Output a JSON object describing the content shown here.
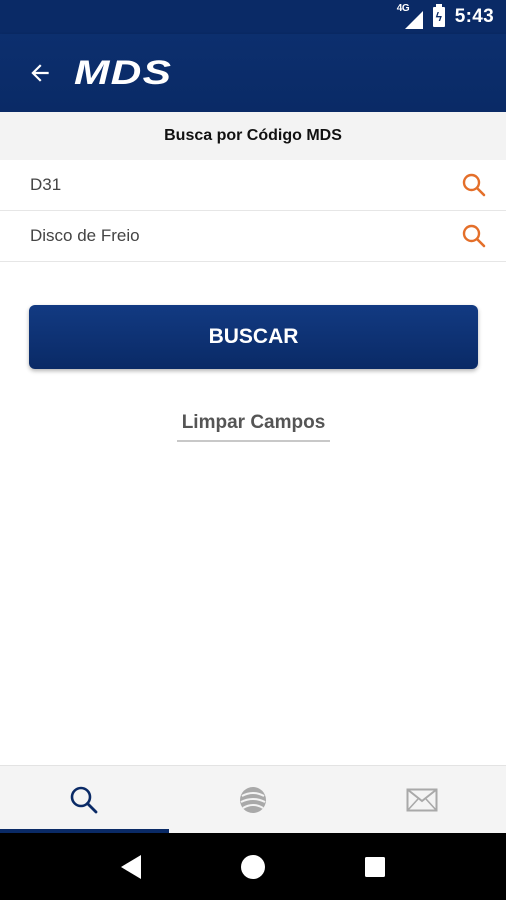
{
  "status_bar": {
    "network_label": "4G",
    "time": "5:43"
  },
  "app_bar": {
    "back_icon": "arrow-left-icon",
    "logo_text": "MDS"
  },
  "section": {
    "title": "Busca por Código MDS"
  },
  "fields": [
    {
      "value": "D31",
      "icon": "search-icon"
    },
    {
      "value": "Disco de Freio",
      "icon": "search-icon"
    }
  ],
  "actions": {
    "search_label": "BUSCAR",
    "clear_label": "Limpar Campos"
  },
  "bottom_nav": {
    "items": [
      {
        "icon": "search-icon",
        "active": true
      },
      {
        "icon": "globe-icon",
        "active": false
      },
      {
        "icon": "mail-icon",
        "active": false
      }
    ]
  },
  "system_nav": {
    "items": [
      "back-triangle-icon",
      "home-circle-icon",
      "recents-square-icon"
    ]
  },
  "colors": {
    "brand_navy": "#0a2a66",
    "accent_orange": "#e46f2a",
    "section_bg": "#f3f3f3"
  }
}
